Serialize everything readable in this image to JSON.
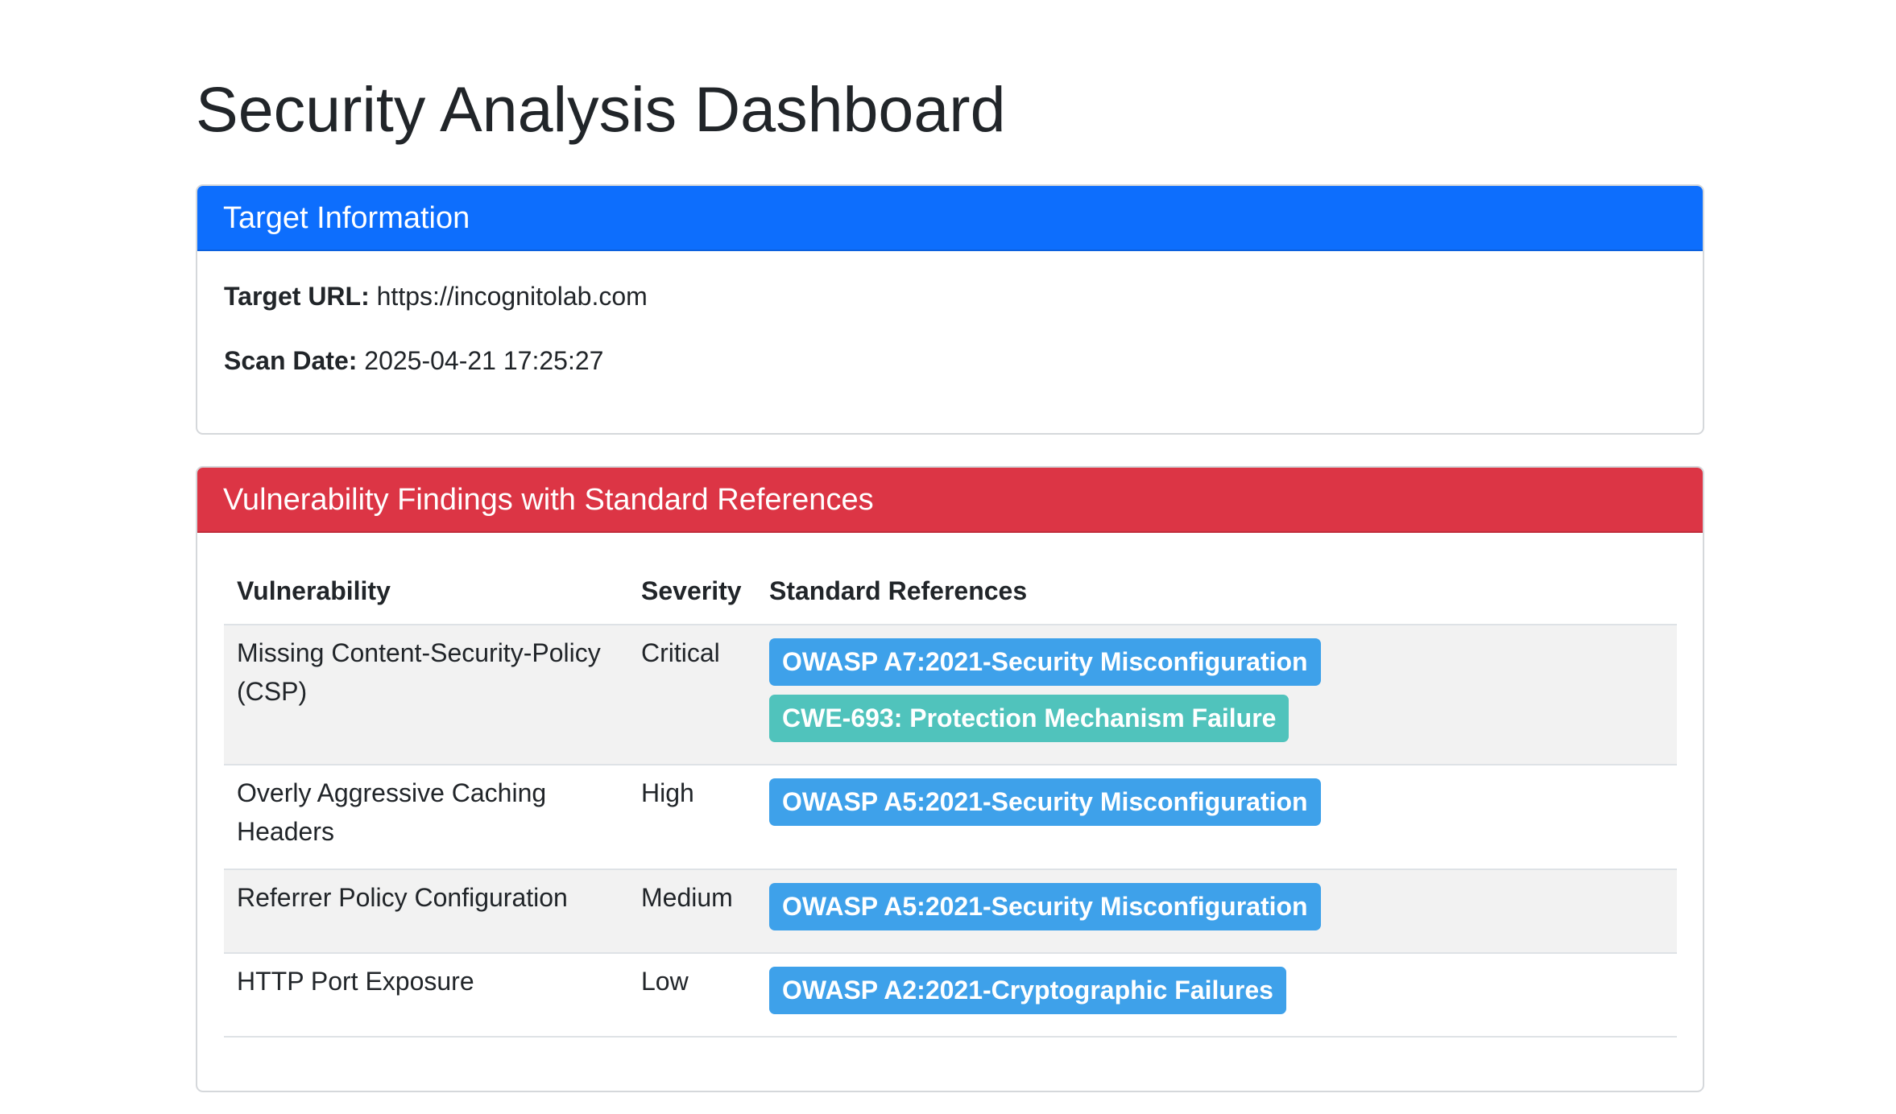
{
  "page": {
    "title": "Security Analysis Dashboard"
  },
  "target_card": {
    "header": "Target Information",
    "url_label": "Target URL:",
    "url_value": "https://incognitolab.com",
    "date_label": "Scan Date:",
    "date_value": "2025-04-21 17:25:27"
  },
  "vuln_card": {
    "header": "Vulnerability Findings with Standard References",
    "columns": [
      "Vulnerability",
      "Severity",
      "Standard References"
    ],
    "rows": [
      {
        "vulnerability": "Missing Content-Security-Policy (CSP)",
        "severity": "Critical",
        "references": [
          {
            "text": "OWASP A7:2021-Security Misconfiguration",
            "kind": "owasp"
          },
          {
            "text": "CWE-693: Protection Mechanism Failure",
            "kind": "cwe"
          }
        ]
      },
      {
        "vulnerability": "Overly Aggressive Caching Headers",
        "severity": "High",
        "references": [
          {
            "text": "OWASP A5:2021-Security Misconfiguration",
            "kind": "owasp"
          }
        ]
      },
      {
        "vulnerability": "Referrer Policy Configuration",
        "severity": "Medium",
        "references": [
          {
            "text": "OWASP A5:2021-Security Misconfiguration",
            "kind": "owasp"
          }
        ]
      },
      {
        "vulnerability": "HTTP Port Exposure",
        "severity": "Low",
        "references": [
          {
            "text": "OWASP A2:2021-Cryptographic Failures",
            "kind": "owasp"
          }
        ]
      }
    ]
  },
  "colors": {
    "primary": "#0d6efd",
    "danger": "#dc3545",
    "owasp_badge": "#3ea1ea",
    "cwe_badge": "#50c3bc"
  }
}
